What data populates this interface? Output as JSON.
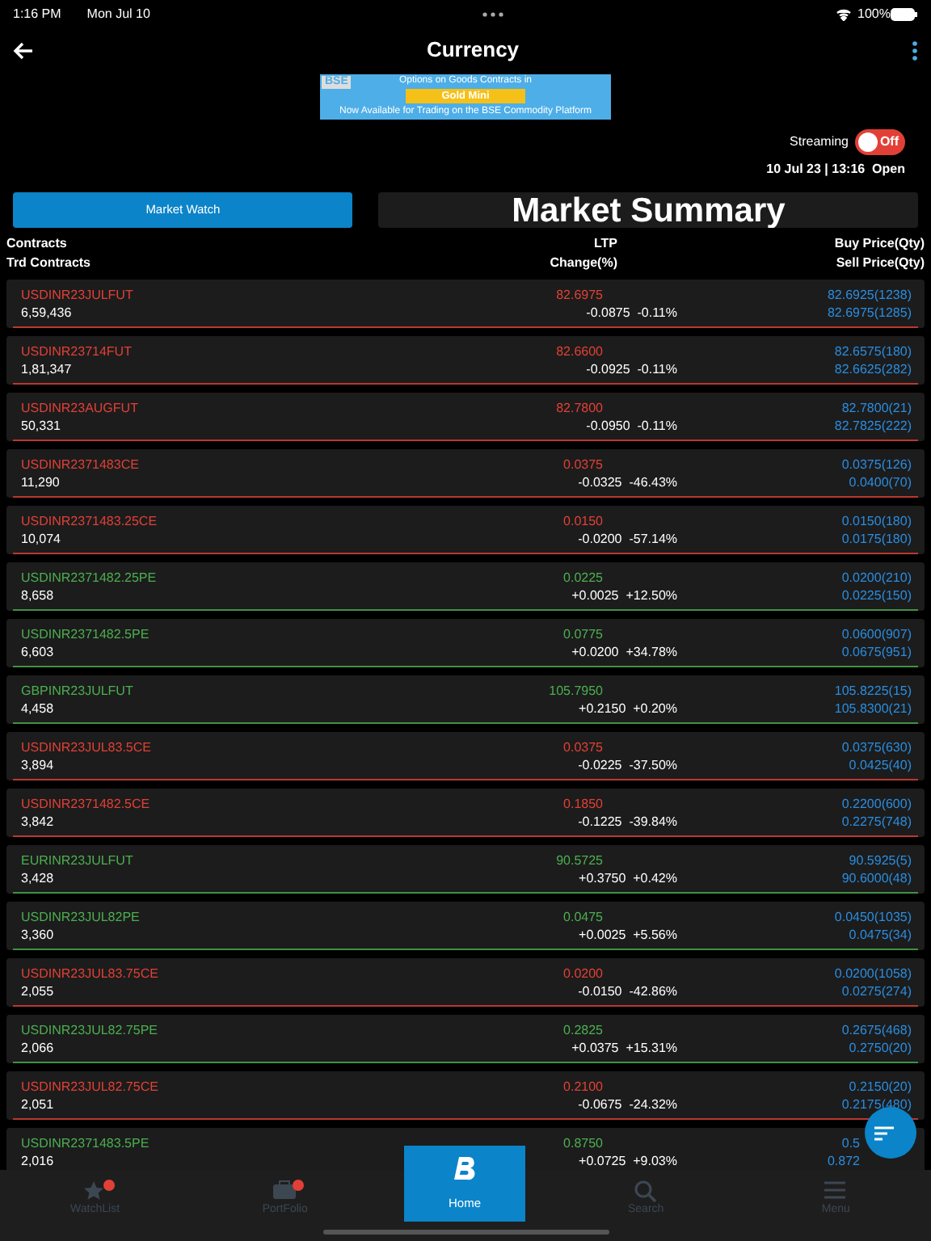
{
  "status_bar": {
    "time": "1:16 PM",
    "date": "Mon Jul 10",
    "battery": "100%"
  },
  "header": {
    "title": "Currency"
  },
  "banner": {
    "logo": "BSE",
    "line1": "Options on Goods Contracts in",
    "highlight": "Gold Mini",
    "line2": "Now Available for Trading on the BSE Commodity Platform"
  },
  "streaming": {
    "label": "Streaming",
    "on": false,
    "state_text": "Off"
  },
  "market_status": "10 Jul 23 | 13:16  Open",
  "tabs": [
    {
      "label": "Market Watch",
      "selected": true
    },
    {
      "label": "Market Summary",
      "selected": false
    }
  ],
  "columns": {
    "left": [
      "Contracts",
      "Trd Contracts"
    ],
    "middle": [
      "LTP",
      "Change(%)"
    ],
    "right": [
      "Buy Price(Qty)",
      "Sell Price(Qty)"
    ]
  },
  "rows": [
    {
      "name": "USDINR23JULFUT",
      "volume": "6,59,436",
      "ltp": "82.6975",
      "change": "-0.0875",
      "change_pct": "-0.11%",
      "buy": "82.6925(1238)",
      "sell": "82.6975(1285)",
      "color": "#e24036"
    },
    {
      "name": "USDINR23714FUT",
      "volume": "1,81,347",
      "ltp": "82.6600",
      "change": "-0.0925",
      "change_pct": "-0.11%",
      "buy": "82.6575(180)",
      "sell": "82.6625(282)",
      "color": "#e24036"
    },
    {
      "name": "USDINR23AUGFUT",
      "volume": "50,331",
      "ltp": "82.7800",
      "change": "-0.0950",
      "change_pct": "-0.11%",
      "buy": "82.7800(21)",
      "sell": "82.7825(222)",
      "color": "#e24036"
    },
    {
      "name": "USDINR2371483CE",
      "volume": "11,290",
      "ltp": "0.0375",
      "change": "-0.0325",
      "change_pct": "-46.43%",
      "buy": "0.0375(126)",
      "sell": "0.0400(70)",
      "color": "#e24036"
    },
    {
      "name": "USDINR2371483.25CE",
      "volume": "10,074",
      "ltp": "0.0150",
      "change": "-0.0200",
      "change_pct": "-57.14%",
      "buy": "0.0150(180)",
      "sell": "0.0175(180)",
      "color": "#e24036"
    },
    {
      "name": "USDINR2371482.25PE",
      "volume": "8,658",
      "ltp": "0.0225",
      "change": "+0.0025",
      "change_pct": "+12.50%",
      "buy": "0.0200(210)",
      "sell": "0.0225(150)",
      "color": "#4caf50"
    },
    {
      "name": "USDINR2371482.5PE",
      "volume": "6,603",
      "ltp": "0.0775",
      "change": "+0.0200",
      "change_pct": "+34.78%",
      "buy": "0.0600(907)",
      "sell": "0.0675(951)",
      "color": "#4caf50"
    },
    {
      "name": "GBPINR23JULFUT",
      "volume": "4,458",
      "ltp": "105.7950",
      "change": "+0.2150",
      "change_pct": "+0.20%",
      "buy": "105.8225(15)",
      "sell": "105.8300(21)",
      "color": "#4caf50"
    },
    {
      "name": "USDINR23JUL83.5CE",
      "volume": "3,894",
      "ltp": "0.0375",
      "change": "-0.0225",
      "change_pct": "-37.50%",
      "buy": "0.0375(630)",
      "sell": "0.0425(40)",
      "color": "#e24036"
    },
    {
      "name": "USDINR2371482.5CE",
      "volume": "3,842",
      "ltp": "0.1850",
      "change": "-0.1225",
      "change_pct": "-39.84%",
      "buy": "0.2200(600)",
      "sell": "0.2275(748)",
      "color": "#e24036"
    },
    {
      "name": "EURINR23JULFUT",
      "volume": "3,428",
      "ltp": "90.5725",
      "change": "+0.3750",
      "change_pct": "+0.42%",
      "buy": "90.5925(5)",
      "sell": "90.6000(48)",
      "color": "#4caf50"
    },
    {
      "name": "USDINR23JUL82PE",
      "volume": "3,360",
      "ltp": "0.0475",
      "change": "+0.0025",
      "change_pct": "+5.56%",
      "buy": "0.0450(1035)",
      "sell": "0.0475(34)",
      "color": "#4caf50"
    },
    {
      "name": "USDINR23JUL83.75CE",
      "volume": "2,055",
      "ltp": "0.0200",
      "change": "-0.0150",
      "change_pct": "-42.86%",
      "buy": "0.0200(1058)",
      "sell": "0.0275(274)",
      "color": "#e24036"
    },
    {
      "name": "USDINR23JUL82.75PE",
      "volume": "2,066",
      "ltp": "0.2825",
      "change": "+0.0375",
      "change_pct": "+15.31%",
      "buy": "0.2675(468)",
      "sell": "0.2750(20)",
      "color": "#4caf50"
    },
    {
      "name": "USDINR23JUL82.75CE",
      "volume": "2,051",
      "ltp": "0.2100",
      "change": "-0.0675",
      "change_pct": "-24.32%",
      "buy": "0.2150(20)",
      "sell": "0.2175(480)",
      "color": "#e24036"
    },
    {
      "name": "USDINR2371483.5PE",
      "volume": "2,016",
      "ltp": "0.8750",
      "change": "+0.0725",
      "change_pct": "+9.03%",
      "buy": "0.5",
      "sell": "0.872",
      "color": "#4caf50",
      "partly_hidden": true
    }
  ],
  "bottom_nav": [
    {
      "label": "WatchList",
      "selected": false,
      "badge": true,
      "kind": "watchlist"
    },
    {
      "label": "PortFolio",
      "selected": false,
      "badge": true,
      "kind": "portfolio"
    },
    {
      "label": "Home",
      "selected": true,
      "badge": false,
      "kind": "home"
    },
    {
      "label": "Search",
      "selected": false,
      "badge": false,
      "kind": "search"
    },
    {
      "label": "Menu",
      "selected": false,
      "badge": false,
      "kind": "menu"
    }
  ]
}
